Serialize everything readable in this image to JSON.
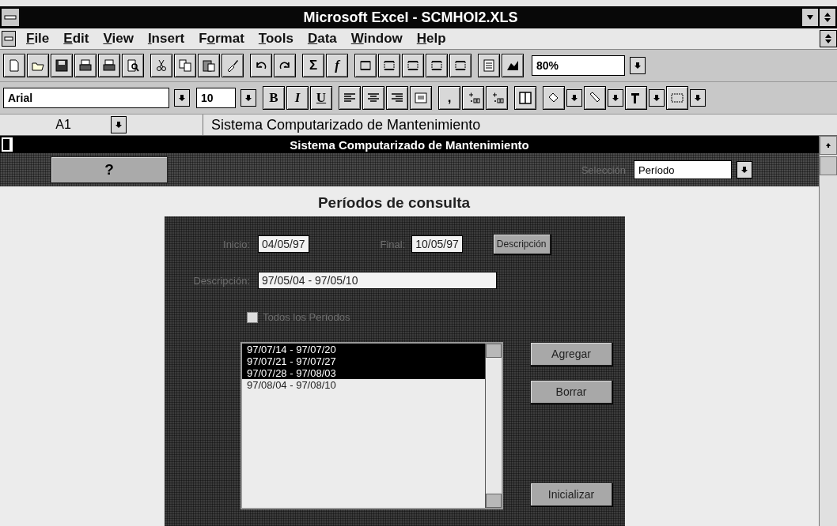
{
  "window": {
    "title": "Microsoft Excel - SCMHOI2.XLS"
  },
  "menu": [
    {
      "key": "F",
      "rest": "ile"
    },
    {
      "key": "E",
      "rest": "dit"
    },
    {
      "key": "V",
      "rest": "iew"
    },
    {
      "key": "I",
      "rest": "nsert"
    },
    {
      "pre": "F",
      "key": "o",
      "rest": "rmat"
    },
    {
      "key": "T",
      "rest": "ools"
    },
    {
      "key": "D",
      "rest": "ata"
    },
    {
      "key": "W",
      "rest": "indow"
    },
    {
      "key": "H",
      "rest": "elp"
    }
  ],
  "toolbar": {
    "sum": "Σ",
    "function": "f",
    "zoom": "80%",
    "font": "Arial",
    "size": "10",
    "bold": "B",
    "italic": "I",
    "underline": "U",
    "comma": ","
  },
  "formula_bar": {
    "cell": "A1",
    "content": "Sistema Computarizado de Mantenimiento"
  },
  "sheet": {
    "header": "Sistema Computarizado de Mantenimiento",
    "help_button": "?",
    "selection_label": "Selección",
    "selection_value": "Período",
    "heading": "Períodos de consulta",
    "form": {
      "start_label": "Inicio:",
      "start_value": "04/05/97",
      "end_label": "Final:",
      "end_value": "10/05/97",
      "description_button": "Descripción",
      "description_label": "Descripción:",
      "description_value": "97/05/04 - 97/05/10",
      "all_periods": {
        "label": "Todos los Períodos",
        "checked": false
      },
      "periods": [
        {
          "text": "97/07/14 - 97/07/20",
          "selected": true
        },
        {
          "text": "97/07/21 - 97/07/27",
          "selected": true
        },
        {
          "text": "97/07/28 - 97/08/03",
          "selected": true
        },
        {
          "text": "97/08/04 - 97/08/10",
          "selected": false
        }
      ],
      "buttons": [
        "Agregar",
        "Borrar",
        "Inicializar"
      ]
    }
  }
}
